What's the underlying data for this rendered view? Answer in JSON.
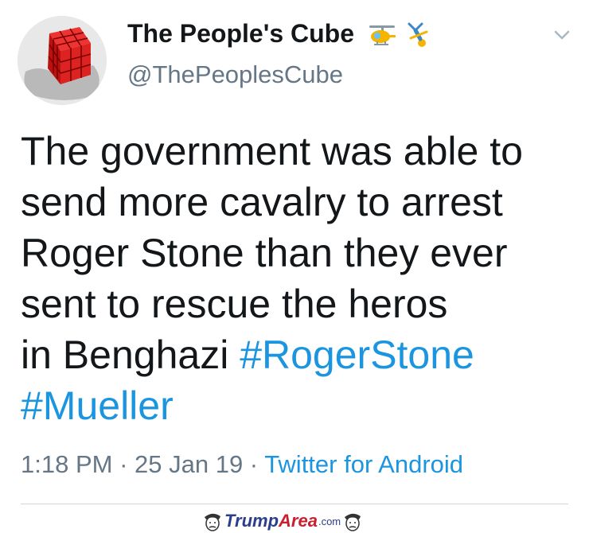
{
  "tweet": {
    "display_name": "The People's Cube",
    "name_emojis": [
      "helicopter-emoji",
      "upside-down-person-emoji"
    ],
    "handle": "@ThePeoplesCube",
    "text_lines": [
      "The government was able to",
      "send more cavalry to arrest",
      "Roger Stone than they ever",
      "sent to rescue the heros"
    ],
    "text_line5_prefix": "in Benghazi ",
    "hashtags": [
      "#RogerStone",
      "#Mueller"
    ],
    "time": "1:18 PM",
    "date": "25 Jan 19",
    "separator": " · ",
    "source": "Twitter for Android"
  },
  "watermark": {
    "brand_first": "Trump",
    "brand_second": "Area",
    "suffix": ".com"
  },
  "colors": {
    "text": "#14171a",
    "secondary": "#657786",
    "link": "#1b95e0",
    "divider": "#ccd6dd"
  }
}
